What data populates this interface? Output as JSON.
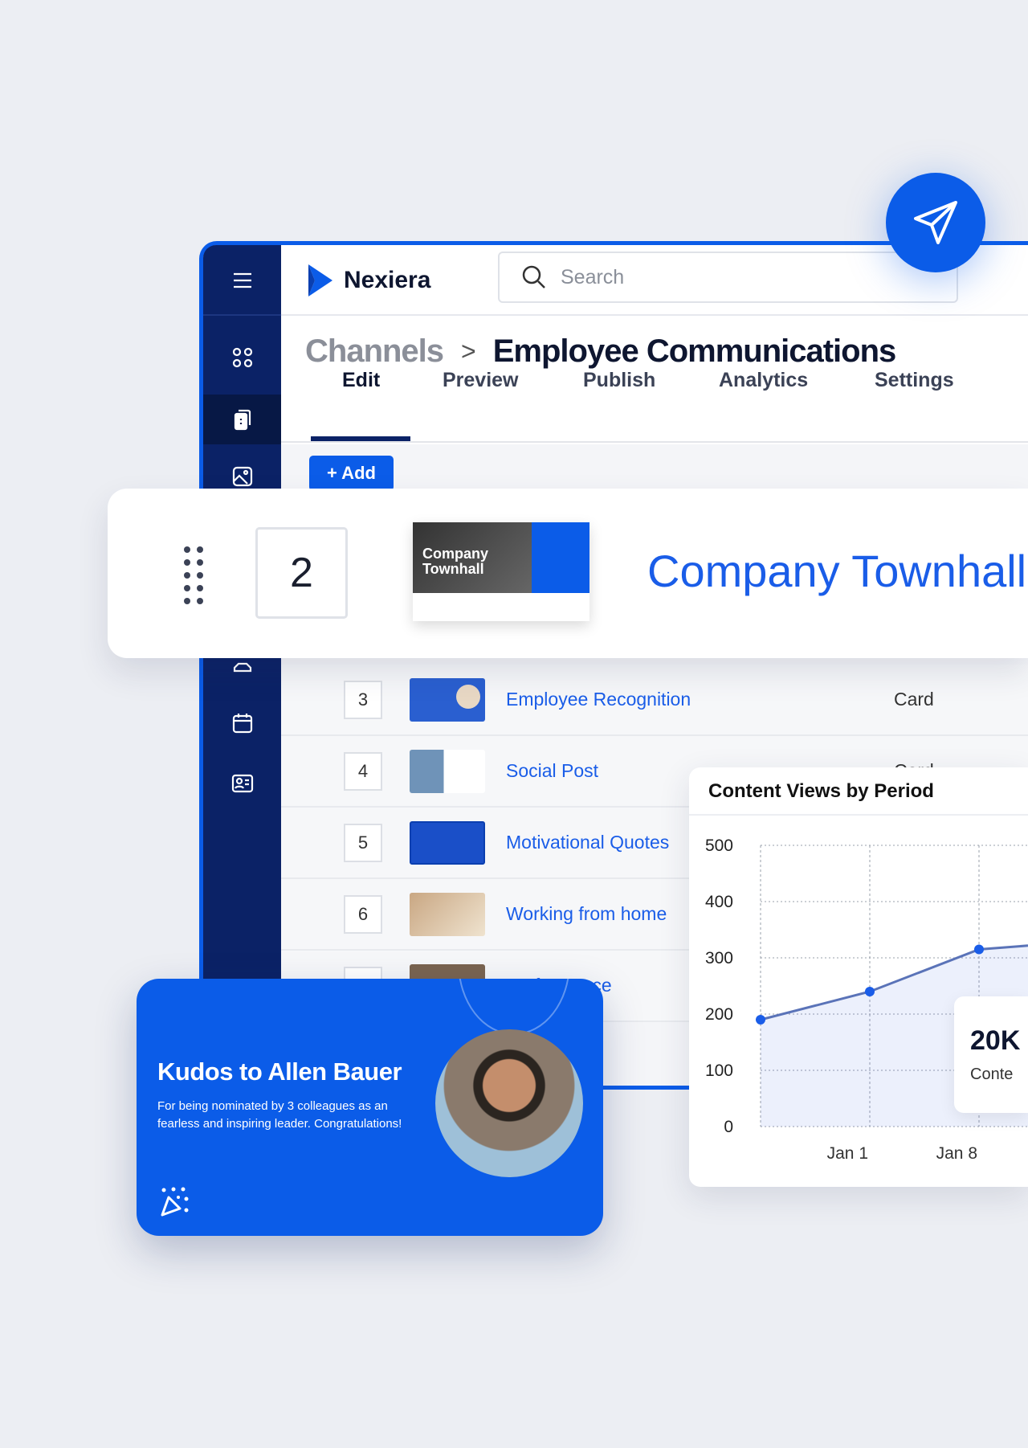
{
  "header": {
    "brand": "Nexiera",
    "search_placeholder": "Search"
  },
  "breadcrumb": {
    "parent": "Channels",
    "separator": ">",
    "current": "Employee Communications"
  },
  "tabs": [
    {
      "label": "Edit",
      "active": true
    },
    {
      "label": "Preview"
    },
    {
      "label": "Publish"
    },
    {
      "label": "Analytics"
    },
    {
      "label": "Settings"
    }
  ],
  "add_button": "+ Add",
  "sidebar": {
    "icons": [
      "menu-icon",
      "grid-icon",
      "document-icon",
      "image-icon",
      "user-icon",
      "calendar-icon",
      "contact-card-icon"
    ]
  },
  "featured_item": {
    "number": "2",
    "title": "Company Townhall",
    "thumb_title": "Company Townhall"
  },
  "items": [
    {
      "number": "3",
      "title": "Employee Recognition",
      "type": "Card"
    },
    {
      "number": "4",
      "title": "Social Post",
      "type": "Card"
    },
    {
      "number": "5",
      "title": "Motivational Quotes",
      "type": ""
    },
    {
      "number": "6",
      "title": "Working from home",
      "type": ""
    },
    {
      "number": "7",
      "title": "Performance",
      "type": ""
    }
  ],
  "kudos": {
    "title": "Kudos to Allen Bauer",
    "body": "For being nominated by 3 colleagues as an fearless and inspiring leader. Congratulations!"
  },
  "stat": {
    "value": "20K",
    "label": "Conte"
  },
  "colors": {
    "brand": "#0b5ce8",
    "navy": "#0b2266",
    "link": "#1a5de8"
  },
  "chart_data": {
    "type": "area",
    "title": "Content Views by Period",
    "ylim": [
      0,
      500
    ],
    "yticks": [
      500,
      400,
      300,
      200,
      100,
      0
    ],
    "x": [
      "",
      "Jan 1",
      "Jan 8",
      ""
    ],
    "values": [
      190,
      240,
      315,
      330
    ],
    "grid": true
  }
}
